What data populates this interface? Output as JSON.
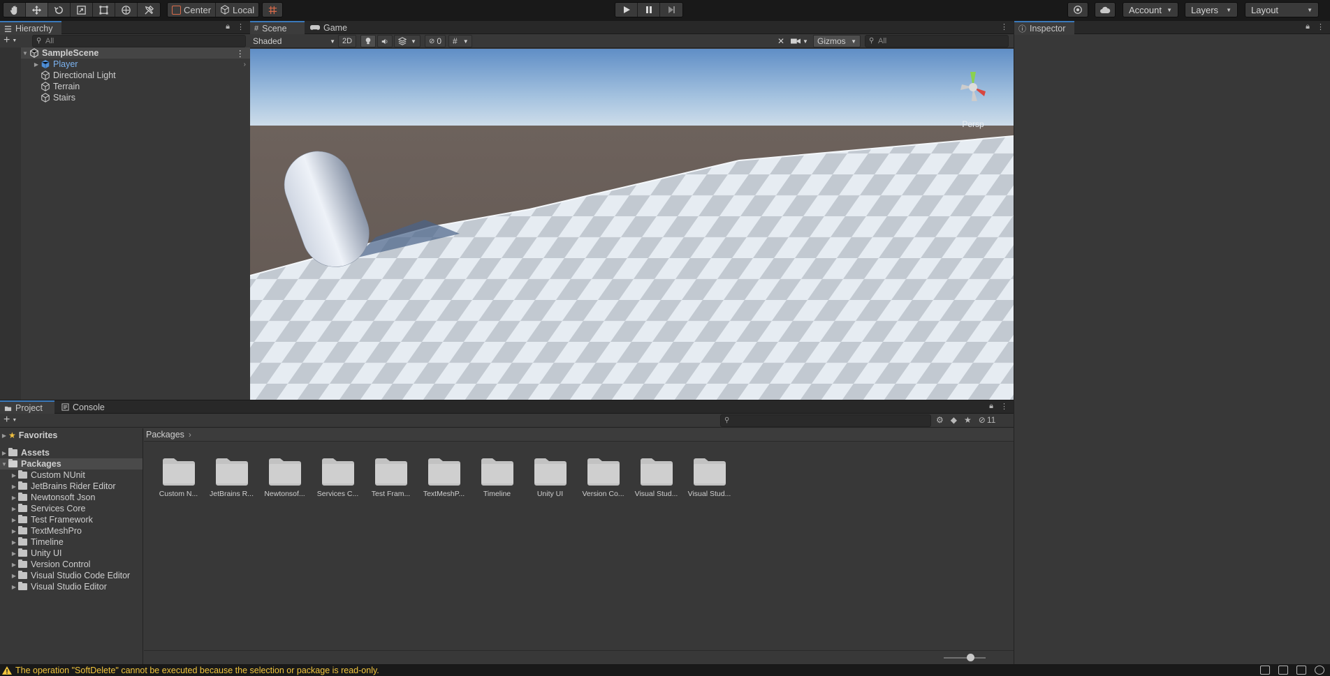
{
  "toolbar": {
    "tools": [
      "hand-tool",
      "move-tool",
      "rotate-tool",
      "scale-tool",
      "rect-tool",
      "transform-tool",
      "custom-tool"
    ],
    "pivot_mode": "Center",
    "pivot_rotation": "Local",
    "account_label": "Account",
    "layers_label": "Layers",
    "layout_label": "Layout"
  },
  "hierarchy": {
    "tab_label": "Hierarchy",
    "search_placeholder": "All",
    "scene_name": "SampleScene",
    "items": [
      {
        "label": "Player",
        "highlight": true
      },
      {
        "label": "Directional Light"
      },
      {
        "label": "Terrain"
      },
      {
        "label": "Stairs"
      }
    ]
  },
  "scene": {
    "tab_scene": "Scene",
    "tab_game": "Game",
    "shading_mode": "Shaded",
    "mode_2d": "2D",
    "hidden_count": "0",
    "gizmos_label": "Gizmos",
    "search_placeholder": "All",
    "persp_label": "Persp"
  },
  "inspector": {
    "tab_label": "Inspector"
  },
  "project": {
    "tab_project": "Project",
    "tab_console": "Console",
    "hidden_packages_count": "11",
    "tree": {
      "favorites": "Favorites",
      "assets": "Assets",
      "packages": "Packages",
      "package_items": [
        "Custom NUnit",
        "JetBrains Rider Editor",
        "Newtonsoft Json",
        "Services Core",
        "Test Framework",
        "TextMeshPro",
        "Timeline",
        "Unity UI",
        "Version Control",
        "Visual Studio Code Editor",
        "Visual Studio Editor"
      ]
    },
    "breadcrumb": "Packages",
    "grid_items": [
      "Custom N...",
      "JetBrains R...",
      "Newtonsof...",
      "Services C...",
      "Test Fram...",
      "TextMeshP...",
      "Timeline",
      "Unity UI",
      "Version Co...",
      "Visual Stud...",
      "Visual Stud..."
    ]
  },
  "status": {
    "message": "The operation \"SoftDelete\" cannot be executed because the selection or package is read-only."
  },
  "colors": {
    "accent": "#3a79bb",
    "warning": "#f2c53d",
    "panel_bg": "#383838",
    "selected_text": "#7cb3f0"
  }
}
